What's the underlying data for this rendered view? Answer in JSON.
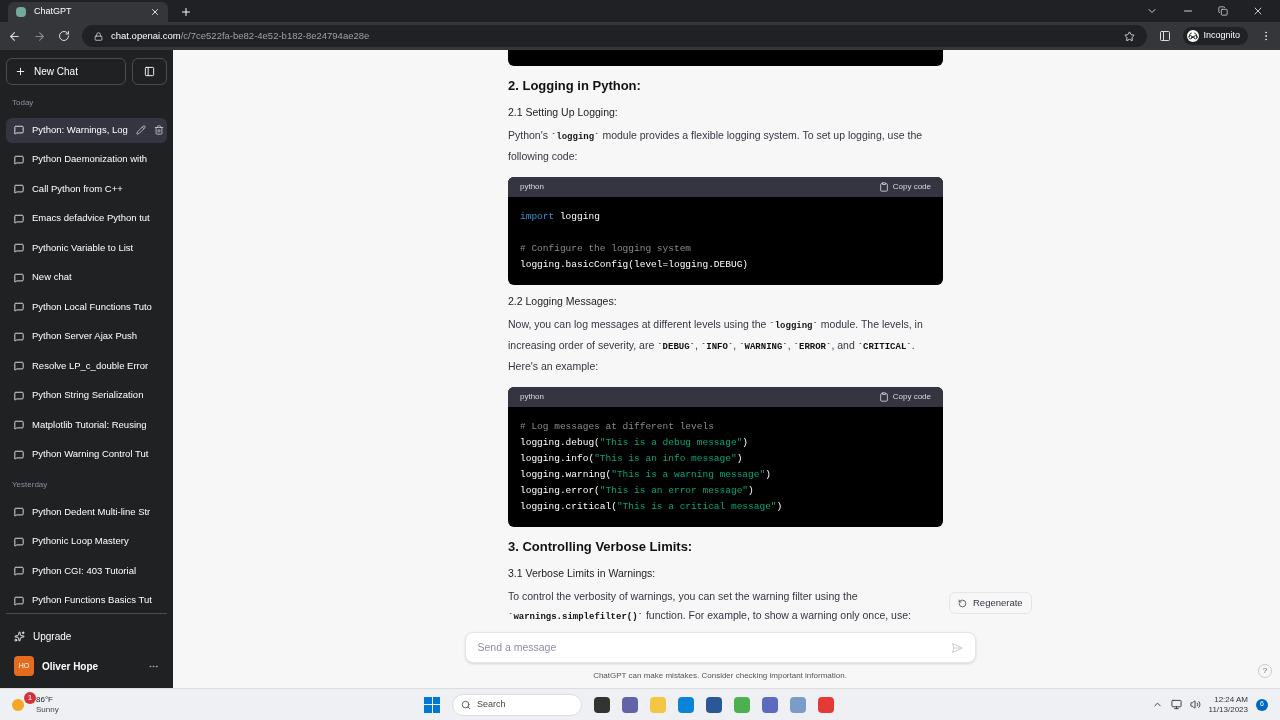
{
  "browser": {
    "tab_title": "ChatGPT",
    "url_host": "chat.openai.com",
    "url_path": "/c/7ce522fa-be82-4e52-b182-8e24794ae28e",
    "profile": "Incognito"
  },
  "sidebar": {
    "new_chat": "New Chat",
    "sections": [
      {
        "label": "Today",
        "items": [
          {
            "title": "Python: Warnings, Log",
            "selected": true
          },
          {
            "title": "Python Daemonization with",
            "selected": false
          },
          {
            "title": "Call Python from C++",
            "selected": false
          },
          {
            "title": "Emacs defadvice Python tut",
            "selected": false
          },
          {
            "title": "Pythonic Variable to List",
            "selected": false
          },
          {
            "title": "New chat",
            "selected": false
          },
          {
            "title": "Python Local Functions Tuto",
            "selected": false
          },
          {
            "title": "Python Server Ajax Push",
            "selected": false
          },
          {
            "title": "Resolve LP_c_double Error",
            "selected": false
          },
          {
            "title": "Python String Serialization",
            "selected": false
          },
          {
            "title": "Matplotlib Tutorial: Reusing",
            "selected": false
          },
          {
            "title": "Python Warning Control Tut",
            "selected": false
          }
        ]
      },
      {
        "label": "Yesterday",
        "items": [
          {
            "title": "Python Dedent Multi-line Str",
            "selected": false
          },
          {
            "title": "Pythonic Loop Mastery",
            "selected": false
          },
          {
            "title": "Python CGI: 403 Tutorial",
            "selected": false
          },
          {
            "title": "Python Functions Basics Tut",
            "selected": false
          }
        ]
      }
    ],
    "upgrade": "Upgrade",
    "user": {
      "initials": "HO",
      "name": "Oliver Hope"
    }
  },
  "content": [
    {
      "kind": "partial_code"
    },
    {
      "kind": "heading",
      "text": "2. Logging in Python:"
    },
    {
      "kind": "subheading",
      "text": "2.1 Setting Up Logging:"
    },
    {
      "kind": "paragraph",
      "parts": [
        {
          "kind": "text",
          "text": "Python's "
        },
        {
          "kind": "code",
          "text": "`logging`"
        },
        {
          "kind": "text",
          "text": " module provides a flexible logging system. To set up logging, use the following code:"
        }
      ]
    },
    {
      "kind": "code",
      "language": "python",
      "copy": "Copy code",
      "lines": [
        [
          {
            "kind": "keyword",
            "text": "import"
          },
          {
            "kind": "plain",
            "text": " logging"
          }
        ],
        [
          {
            "kind": "gap"
          },
          {
            "kind": "comment",
            "text": "# Configure the logging system"
          }
        ],
        [
          {
            "kind": "plain",
            "text": "logging.basicConfig(level=logging.DEBUG)"
          }
        ]
      ]
    },
    {
      "kind": "subheading",
      "text": "2.2 Logging Messages:"
    },
    {
      "kind": "paragraph",
      "parts": [
        {
          "kind": "text",
          "text": "Now, you can log messages at different levels using the "
        },
        {
          "kind": "code",
          "text": "`logging`"
        },
        {
          "kind": "text",
          "text": " module. The levels, in increasing order of severity, are "
        },
        {
          "kind": "code",
          "text": "`DEBUG`"
        },
        {
          "kind": "text",
          "text": ", "
        },
        {
          "kind": "code",
          "text": "`INFO`"
        },
        {
          "kind": "text",
          "text": ", "
        },
        {
          "kind": "code",
          "text": "`WARNING`"
        },
        {
          "kind": "text",
          "text": ", "
        },
        {
          "kind": "code",
          "text": "`ERROR`"
        },
        {
          "kind": "text",
          "text": ", and "
        },
        {
          "kind": "code",
          "text": "`CRITICAL`"
        },
        {
          "kind": "text",
          "text": ". Here's an example:"
        }
      ]
    },
    {
      "kind": "code",
      "language": "python",
      "copy": "Copy code",
      "lines": [
        [
          {
            "kind": "comment",
            "text": "# Log messages at different levels"
          }
        ],
        [
          {
            "kind": "plain",
            "text": "logging.debug("
          },
          {
            "kind": "string",
            "text": "\"This is a debug message\""
          },
          {
            "kind": "plain",
            "text": ")"
          }
        ],
        [
          {
            "kind": "plain",
            "text": "logging.info("
          },
          {
            "kind": "string",
            "text": "\"This is an info message\""
          },
          {
            "kind": "plain",
            "text": ")"
          }
        ],
        [
          {
            "kind": "plain",
            "text": "logging.warning("
          },
          {
            "kind": "string",
            "text": "\"This is a warning message\""
          },
          {
            "kind": "plain",
            "text": ")"
          }
        ],
        [
          {
            "kind": "plain",
            "text": "logging.error("
          },
          {
            "kind": "string",
            "text": "\"This is an error message\""
          },
          {
            "kind": "plain",
            "text": ")"
          }
        ],
        [
          {
            "kind": "plain",
            "text": "logging.critical("
          },
          {
            "kind": "string",
            "text": "\"This is a critical message\""
          },
          {
            "kind": "plain",
            "text": ")"
          }
        ]
      ]
    },
    {
      "kind": "heading",
      "text": "3. Controlling Verbose Limits:"
    },
    {
      "kind": "subheading",
      "text": "3.1 Verbose Limits in Warnings:"
    },
    {
      "kind": "paragraph",
      "parts": [
        {
          "kind": "text",
          "text": "To control the verbosity of warnings, you can set the warning filter using the "
        },
        {
          "kind": "code",
          "text": "`warnings.simplefilter()`"
        },
        {
          "kind": "text",
          "text": " function. For example, to show a warning only once, use:"
        }
      ]
    }
  ],
  "regenerate": "Regenerate",
  "composer": {
    "placeholder": "Send a message"
  },
  "disclaimer": "ChatGPT can make mistakes. Consider checking important information.",
  "help": "?",
  "taskbar": {
    "weather_temp": "86°F",
    "weather_text": "Sunny",
    "weather_badge": "1",
    "search": "Search",
    "time": "12:24 AM",
    "date": "11/13/2023",
    "notifications": "6"
  }
}
